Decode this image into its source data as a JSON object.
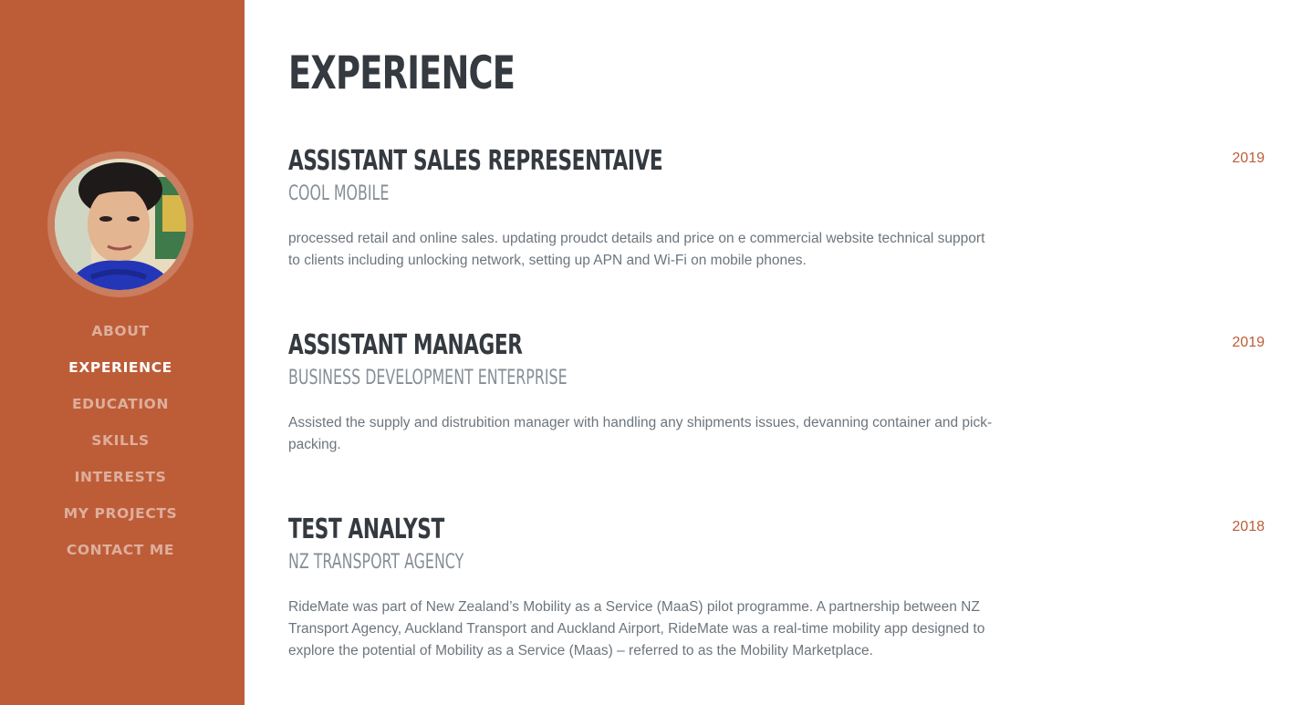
{
  "colors": {
    "sidebar_bg": "#bd5d38",
    "heading": "#343a40",
    "subheading": "#868e96",
    "body_text": "#6c757d",
    "accent": "#bd5d38"
  },
  "sidebar": {
    "avatar_alt": "profile-photo",
    "nav": [
      {
        "label": "ABOUT"
      },
      {
        "label": "EXPERIENCE"
      },
      {
        "label": "EDUCATION"
      },
      {
        "label": "SKILLS"
      },
      {
        "label": "INTERESTS"
      },
      {
        "label": "MY PROJECTS"
      },
      {
        "label": "CONTACT ME"
      }
    ],
    "active_index": 1
  },
  "main": {
    "title": "EXPERIENCE",
    "jobs": [
      {
        "title": "ASSISTANT SALES REPRESENTAIVE",
        "company": "COOL MOBILE",
        "description": "processed retail and online sales. updating proudct details and price on e commercial website technical support to clients including unlocking network, setting up APN and Wi-Fi on mobile phones.",
        "year": "2019"
      },
      {
        "title": "ASSISTANT MANAGER",
        "company": "BUSINESS DEVELOPMENT ENTERPRISE",
        "description": "Assisted the supply and distrubition manager with handling any shipments issues, devanning container and pick-packing.",
        "year": "2019"
      },
      {
        "title": "TEST ANALYST",
        "company": "NZ TRANSPORT AGENCY",
        "description": "RideMate was part of New Zealand’s Mobility as a Service (MaaS) pilot programme. A partnership between NZ Transport Agency, Auckland Transport and Auckland Airport, RideMate was a real-time mobility app designed to explore the potential of Mobility as a Service (Maas) – referred to as the Mobility Marketplace.",
        "year": "2018"
      }
    ]
  }
}
